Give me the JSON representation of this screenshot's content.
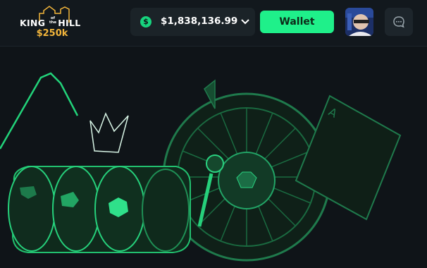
{
  "header": {
    "logo": {
      "line1": "KING",
      "of_the": "of the",
      "line2": "HILL",
      "prize": "$250k"
    },
    "balance": {
      "currency_icon": "$",
      "amount": "$1,838,136.99"
    },
    "wallet_label": "Wallet",
    "icons": {
      "balance_dropdown": "chevron-down-icon",
      "chat": "chat-icon"
    }
  },
  "colors": {
    "background": "#0f1418",
    "header": "#12181d",
    "accent": "#1ff08a",
    "prize": "#f2b53b"
  }
}
